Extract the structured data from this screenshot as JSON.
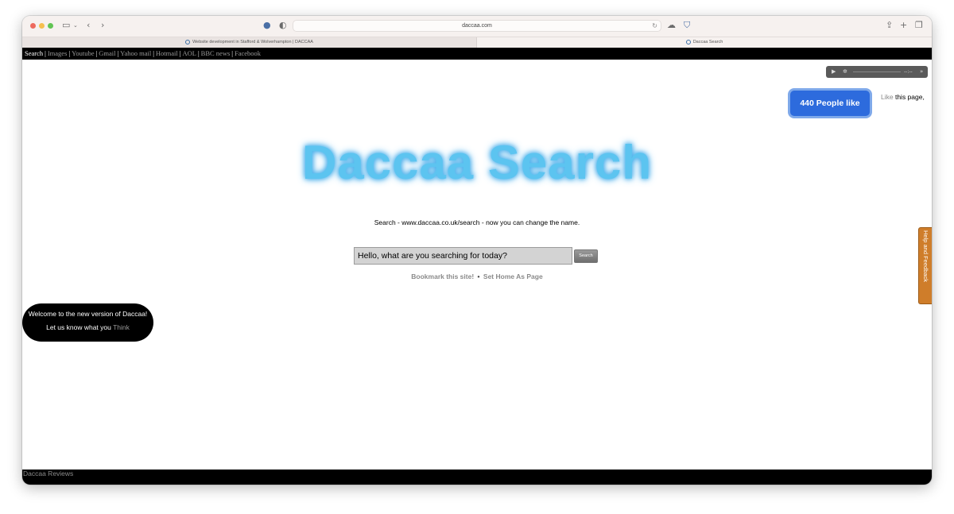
{
  "browser": {
    "url": "daccaa.com",
    "tabs": [
      {
        "label": "Website development in Stafford & Wolverhampton | DACCAA"
      },
      {
        "label": "Daccaa Search"
      }
    ]
  },
  "nav": {
    "items": [
      "Search",
      "Images",
      "Youtube",
      "Gmail",
      "Yahoo mail",
      "Hotmail",
      "AOL",
      "BBC news",
      "Facebook"
    ],
    "separator": "|"
  },
  "player": {
    "time": "--:--"
  },
  "like": {
    "box_label": "440 People like this!",
    "link_label": "Like",
    "suffix": "this page,"
  },
  "logo": "Daccaa Search",
  "tagline": "Search - www.daccaa.co.uk/search - now you can change the name.",
  "search": {
    "value": "Hello, what are you searching for today?",
    "button_label": "Search"
  },
  "bookmark": {
    "bookmark_label": "Bookmark this site!",
    "separator": "•",
    "home_label": "Set Home As Page"
  },
  "welcome": {
    "line1": "Welcome to the new version of Daccaa!",
    "line2_prefix": "Let us know what you",
    "line2_link": "Think"
  },
  "feedback_tab": "Help and Feedback",
  "footer": "Daccaa Reviews",
  "colors": {
    "nav_bg": "#000000",
    "like_box": "#2d6bdd",
    "logo": "#5cc4f0",
    "feedback_tab": "#cf7d2a"
  }
}
